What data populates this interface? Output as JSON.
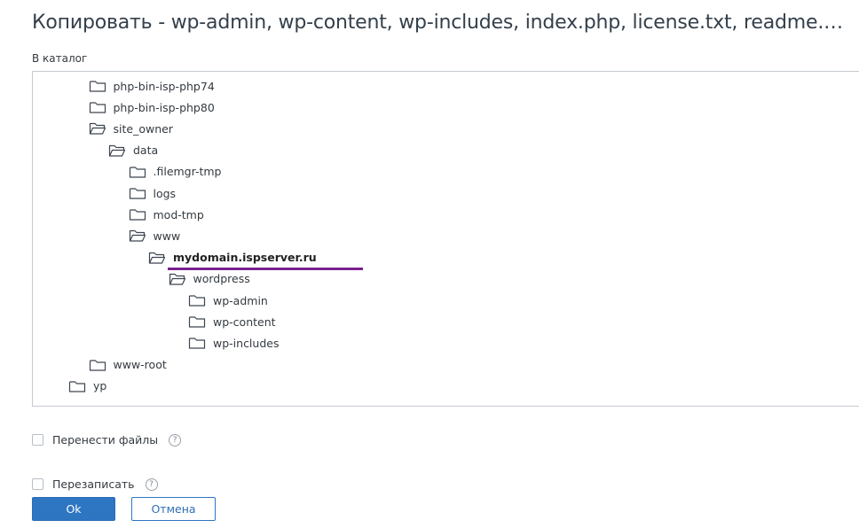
{
  "dialog": {
    "title": "Копировать - wp-admin, wp-content, wp-includes, index.php, license.txt, readme.ht…",
    "dest_label": "В каталог"
  },
  "tree": [
    {
      "label": "php-bin-isp-php74",
      "state": "closed",
      "depth": 2
    },
    {
      "label": "php-bin-isp-php80",
      "state": "closed",
      "depth": 2
    },
    {
      "label": "site_owner",
      "state": "open",
      "depth": 2
    },
    {
      "label": "data",
      "state": "open",
      "depth": 3
    },
    {
      "label": ".filemgr-tmp",
      "state": "closed",
      "depth": 4
    },
    {
      "label": "logs",
      "state": "closed",
      "depth": 4
    },
    {
      "label": "mod-tmp",
      "state": "closed",
      "depth": 4
    },
    {
      "label": "www",
      "state": "open",
      "depth": 4
    },
    {
      "label": "mydomain.ispserver.ru",
      "state": "open",
      "depth": 5,
      "selected": true
    },
    {
      "label": "wordpress",
      "state": "open",
      "depth": 6
    },
    {
      "label": "wp-admin",
      "state": "closed",
      "depth": 7
    },
    {
      "label": "wp-content",
      "state": "closed",
      "depth": 7
    },
    {
      "label": "wp-includes",
      "state": "closed",
      "depth": 7
    },
    {
      "label": "www-root",
      "state": "closed",
      "depth": 2
    },
    {
      "label": "yp",
      "state": "closed",
      "depth": 1
    }
  ],
  "options": {
    "move_label": "Перенести файлы",
    "overwrite_label": "Перезаписать",
    "help_glyph": "?"
  },
  "buttons": {
    "ok": "Ok",
    "cancel": "Отмена"
  },
  "colors": {
    "accent": "#2e75c2",
    "selection_underline": "#7a1f8e"
  }
}
